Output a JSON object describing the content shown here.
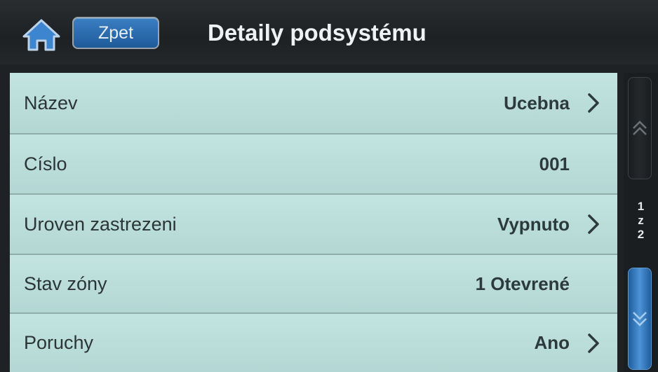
{
  "header": {
    "back_label": "Zpet",
    "title": "Detaily podsystému"
  },
  "rows": [
    {
      "label": "Název",
      "value": "Ucebna",
      "has_chevron": true
    },
    {
      "label": "Císlo",
      "value": "001",
      "has_chevron": false
    },
    {
      "label": "Uroven zastrezeni",
      "value": "Vypnuto",
      "has_chevron": true
    },
    {
      "label": "Stav zóny",
      "value": "1 Otevrené",
      "has_chevron": false
    },
    {
      "label": "Poruchy",
      "value": "Ano",
      "has_chevron": true
    }
  ],
  "pager": {
    "current": "1",
    "separator": "z",
    "total": "2"
  },
  "icons": {
    "home": "home-icon",
    "up": "double-chevron-up-icon",
    "down": "double-chevron-down-icon",
    "row": "chevron-right-icon"
  },
  "colors": {
    "accent": "#2f73b5",
    "list_background": "#b9dcd9",
    "header_background": "#1f2224"
  }
}
